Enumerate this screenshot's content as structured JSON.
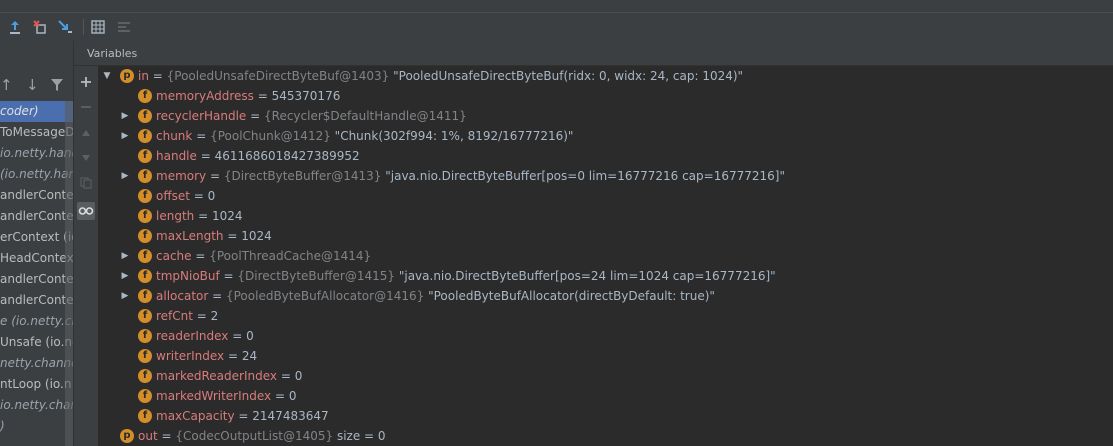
{
  "panel_title": "Variables",
  "toolbar": {
    "buttons": [
      "step-out-icon",
      "drop-frame-icon",
      "run-to-cursor-icon",
      "evaluate-expression-icon",
      "trace-icon"
    ]
  },
  "frames": {
    "items": [
      {
        "text": "coder)",
        "selected": true,
        "italic": true
      },
      {
        "text": "ToMessageD",
        "italic": false
      },
      {
        "text": "io.netty.handle",
        "italic": true
      },
      {
        "text": "(io.netty.han",
        "italic": true
      },
      {
        "text": "andlerContex",
        "italic": false
      },
      {
        "text": "andlerContex",
        "italic": false
      },
      {
        "text": "erContext (io",
        "italic": false
      },
      {
        "text": "HeadContext",
        "italic": false
      },
      {
        "text": "andlerContex",
        "italic": false
      },
      {
        "text": "andlerContex",
        "italic": false
      },
      {
        "text": "e (io.netty.ch",
        "italic": true
      },
      {
        "text": "Unsafe (io.ne",
        "italic": false
      },
      {
        "text": "netty.channe",
        "italic": true
      },
      {
        "text": "ntLoop (io.n",
        "italic": false
      },
      {
        "text": "io.netty.channe",
        "italic": true
      },
      {
        "text": ")",
        "italic": true
      }
    ]
  },
  "variables": [
    {
      "level": 0,
      "expand": "open",
      "badge": "p",
      "name": "in",
      "type": "{PooledUnsafeDirectByteBuf@1403}",
      "value": "\"PooledUnsafeDirectByteBuf(ridx: 0, widx: 24, cap: 1024)\""
    },
    {
      "level": 1,
      "expand": "none",
      "badge": "f",
      "name": "memoryAddress",
      "type": "",
      "value": "545370176"
    },
    {
      "level": 1,
      "expand": "closed",
      "badge": "f",
      "name": "recyclerHandle",
      "type": "{Recycler$DefaultHandle@1411}",
      "value": ""
    },
    {
      "level": 1,
      "expand": "closed",
      "badge": "f",
      "name": "chunk",
      "type": "{PoolChunk@1412}",
      "value": "\"Chunk(302f994: 1%, 8192/16777216)\""
    },
    {
      "level": 1,
      "expand": "none",
      "badge": "f",
      "name": "handle",
      "type": "",
      "value": "4611686018427389952"
    },
    {
      "level": 1,
      "expand": "closed",
      "badge": "f",
      "name": "memory",
      "type": "{DirectByteBuffer@1413}",
      "value": "\"java.nio.DirectByteBuffer[pos=0 lim=16777216 cap=16777216]\""
    },
    {
      "level": 1,
      "expand": "none",
      "badge": "f",
      "name": "offset",
      "type": "",
      "value": "0"
    },
    {
      "level": 1,
      "expand": "none",
      "badge": "f",
      "name": "length",
      "type": "",
      "value": "1024"
    },
    {
      "level": 1,
      "expand": "none",
      "badge": "f",
      "name": "maxLength",
      "type": "",
      "value": "1024"
    },
    {
      "level": 1,
      "expand": "closed",
      "badge": "f",
      "name": "cache",
      "type": "{PoolThreadCache@1414}",
      "value": ""
    },
    {
      "level": 1,
      "expand": "closed",
      "badge": "f",
      "name": "tmpNioBuf",
      "type": "{DirectByteBuffer@1415}",
      "value": "\"java.nio.DirectByteBuffer[pos=24 lim=1024 cap=16777216]\""
    },
    {
      "level": 1,
      "expand": "closed",
      "badge": "f",
      "name": "allocator",
      "type": "{PooledByteBufAllocator@1416}",
      "value": "\"PooledByteBufAllocator(directByDefault: true)\""
    },
    {
      "level": 1,
      "expand": "none",
      "badge": "f",
      "name": "refCnt",
      "type": "",
      "value": "2"
    },
    {
      "level": 1,
      "expand": "none",
      "badge": "f",
      "name": "readerIndex",
      "type": "",
      "value": "0"
    },
    {
      "level": 1,
      "expand": "none",
      "badge": "f",
      "name": "writerIndex",
      "type": "",
      "value": "24"
    },
    {
      "level": 1,
      "expand": "none",
      "badge": "f",
      "name": "markedReaderIndex",
      "type": "",
      "value": "0"
    },
    {
      "level": 1,
      "expand": "none",
      "badge": "f",
      "name": "markedWriterIndex",
      "type": "",
      "value": "0"
    },
    {
      "level": 1,
      "expand": "none",
      "badge": "f",
      "name": "maxCapacity",
      "type": "",
      "value": "2147483647"
    },
    {
      "level": 0,
      "expand": "none",
      "badge": "p",
      "name": "out",
      "type": "{CodecOutputList@1405}",
      "value": "size = 0"
    }
  ]
}
